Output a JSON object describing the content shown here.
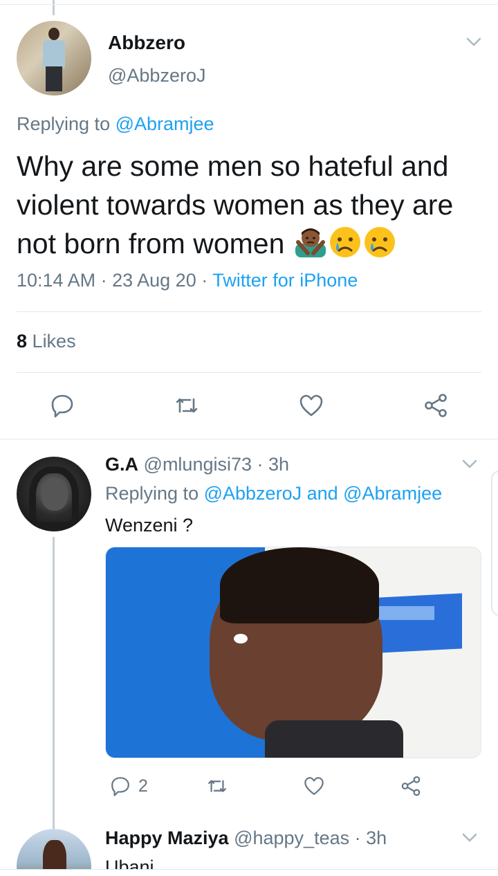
{
  "main_tweet": {
    "author_name": "Abbzero",
    "author_handle": "@AbbzeroJ",
    "replying_label": "Replying to",
    "replying_to": "@Abramjee",
    "text": "Why are some men so hateful and violent towards women as they are not born from women",
    "emojis": [
      "person-gesturing-no-emoji",
      "crying-face-emoji",
      "crying-face-emoji"
    ],
    "time": "10:14 AM",
    "date": "23 Aug 20",
    "source": "Twitter for iPhone",
    "likes_count": "8",
    "likes_label": "Likes"
  },
  "reply_1": {
    "author_name": "G.A",
    "author_handle": "@mlungisi73",
    "age": "3h",
    "replying_label": "Replying to",
    "replying_to": "@AbbzeroJ and @Abramjee",
    "text": "Wenzeni ?",
    "reply_count": "2"
  },
  "reply_2": {
    "author_name": "Happy Maziya",
    "author_handle": "@happy_teas",
    "age": "3h",
    "text": "Ubani"
  },
  "colors": {
    "accent": "#1da1f2",
    "secondary_text": "#657786",
    "primary_text": "#14171a",
    "divider": "#e1e8ed",
    "thread_line": "#c4cfd6"
  }
}
